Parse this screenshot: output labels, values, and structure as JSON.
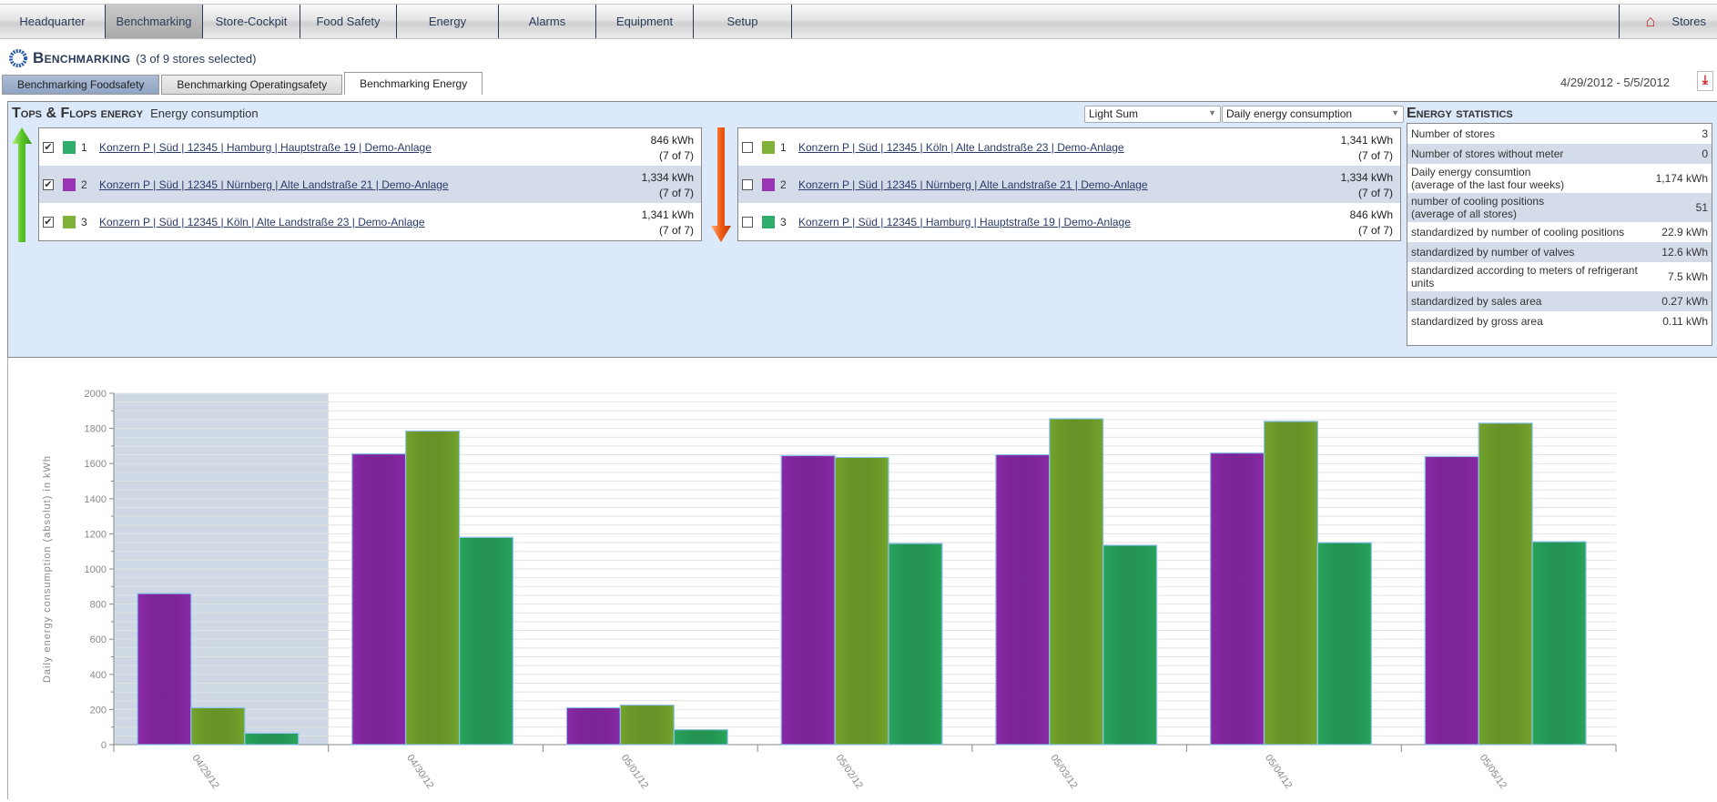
{
  "nav": {
    "items": [
      "Headquarter",
      "Benchmarking",
      "Store-Cockpit",
      "Food Safety",
      "Energy",
      "Alarms",
      "Equipment",
      "Setup"
    ],
    "active": "Benchmarking",
    "stores": "Stores",
    "stores_icon": "houses-icon"
  },
  "page": {
    "title": "Benchmarking",
    "subtitle": "(3 of 9 stores selected)",
    "logo_icon": "sunburst-logo-icon"
  },
  "tabs": [
    {
      "label": "Benchmarking Foodsafety"
    },
    {
      "label": "Benchmarking Operatingsafety"
    },
    {
      "label": "Benchmarking Energy",
      "active": true
    }
  ],
  "date_range": "4/29/2012 - 5/5/2012",
  "pdf_icon": "pdf-export-icon",
  "tops_flops": {
    "title": "Tops & Flops energy",
    "subtitle": "Energy consumption",
    "select_mode": "Light Sum",
    "select_metric": "Daily energy consumption",
    "tops": [
      {
        "checked": true,
        "color": "#2eae6a",
        "rank": "1",
        "store": "Konzern P | Süd | 12345 | Hamburg | Hauptstraße 19 | Demo-Anlage",
        "value": "846 kWh",
        "coverage": "(7 of 7)"
      },
      {
        "checked": true,
        "color": "#9a35b5",
        "rank": "2",
        "store": "Konzern P | Süd | 12345 | Nürnberg | Alte Landstraße 21 | Demo-Anlage",
        "value": "1,334 kWh",
        "coverage": "(7 of 7)"
      },
      {
        "checked": true,
        "color": "#7fb236",
        "rank": "3",
        "store": "Konzern P | Süd | 12345 | Köln | Alte Landstraße 23 | Demo-Anlage",
        "value": "1,341 kWh",
        "coverage": "(7 of 7)"
      }
    ],
    "flops": [
      {
        "checked": false,
        "color": "#7fb236",
        "rank": "1",
        "store": "Konzern P | Süd | 12345 | Köln | Alte Landstraße 23 | Demo-Anlage",
        "value": "1,341 kWh",
        "coverage": "(7 of 7)"
      },
      {
        "checked": false,
        "color": "#9a35b5",
        "rank": "2",
        "store": "Konzern P | Süd | 12345 | Nürnberg | Alte Landstraße 21 | Demo-Anlage",
        "value": "1,334 kWh",
        "coverage": "(7 of 7)"
      },
      {
        "checked": false,
        "color": "#2eae6a",
        "rank": "3",
        "store": "Konzern P | Süd | 12345 | Hamburg | Hauptstraße 19 | Demo-Anlage",
        "value": "846 kWh",
        "coverage": "(7 of 7)"
      }
    ]
  },
  "stats": {
    "title": "Energy statistics",
    "rows": [
      {
        "label": "Number of stores",
        "value": "3"
      },
      {
        "label": "Number of stores without meter",
        "value": "0"
      },
      {
        "label": "Daily energy consumtion\n(average of the last four weeks)",
        "value": "1,174 kWh"
      },
      {
        "label": "number of cooling positions\n(average of all stores)",
        "value": "51"
      },
      {
        "label": "standardized by number of cooling positions",
        "value": "22.9 kWh"
      },
      {
        "label": "standardized by number of valves",
        "value": "12.6 kWh"
      },
      {
        "label": "standardized according to meters of refrigerant units",
        "value": "7.5 kWh"
      },
      {
        "label": "standardized by sales area",
        "value": "0.27 kWh"
      },
      {
        "label": "standardized by gross area",
        "value": "0.11 kWh"
      }
    ]
  },
  "chart_data": {
    "type": "bar",
    "title": "",
    "xlabel": "",
    "ylabel": "Daily energy consumption (absolut) in kWh",
    "ylim": [
      0,
      2000
    ],
    "yticks": [
      0,
      200,
      400,
      600,
      800,
      1000,
      1200,
      1400,
      1600,
      1800,
      2000
    ],
    "grid": true,
    "highlighted_category": "04/29/12",
    "categories": [
      "04/29/12",
      "04/30/12",
      "05/01/12",
      "05/02/12",
      "05/03/12",
      "05/04/12",
      "05/05/12"
    ],
    "series": [
      {
        "color": "#8a2aa8",
        "values": [
          860,
          1655,
          210,
          1645,
          1650,
          1660,
          1640
        ]
      },
      {
        "color": "#74a42c",
        "values": [
          210,
          1785,
          225,
          1635,
          1855,
          1840,
          1830
        ]
      },
      {
        "color": "#28a55c",
        "values": [
          65,
          1180,
          85,
          1145,
          1135,
          1150,
          1155
        ]
      }
    ]
  }
}
